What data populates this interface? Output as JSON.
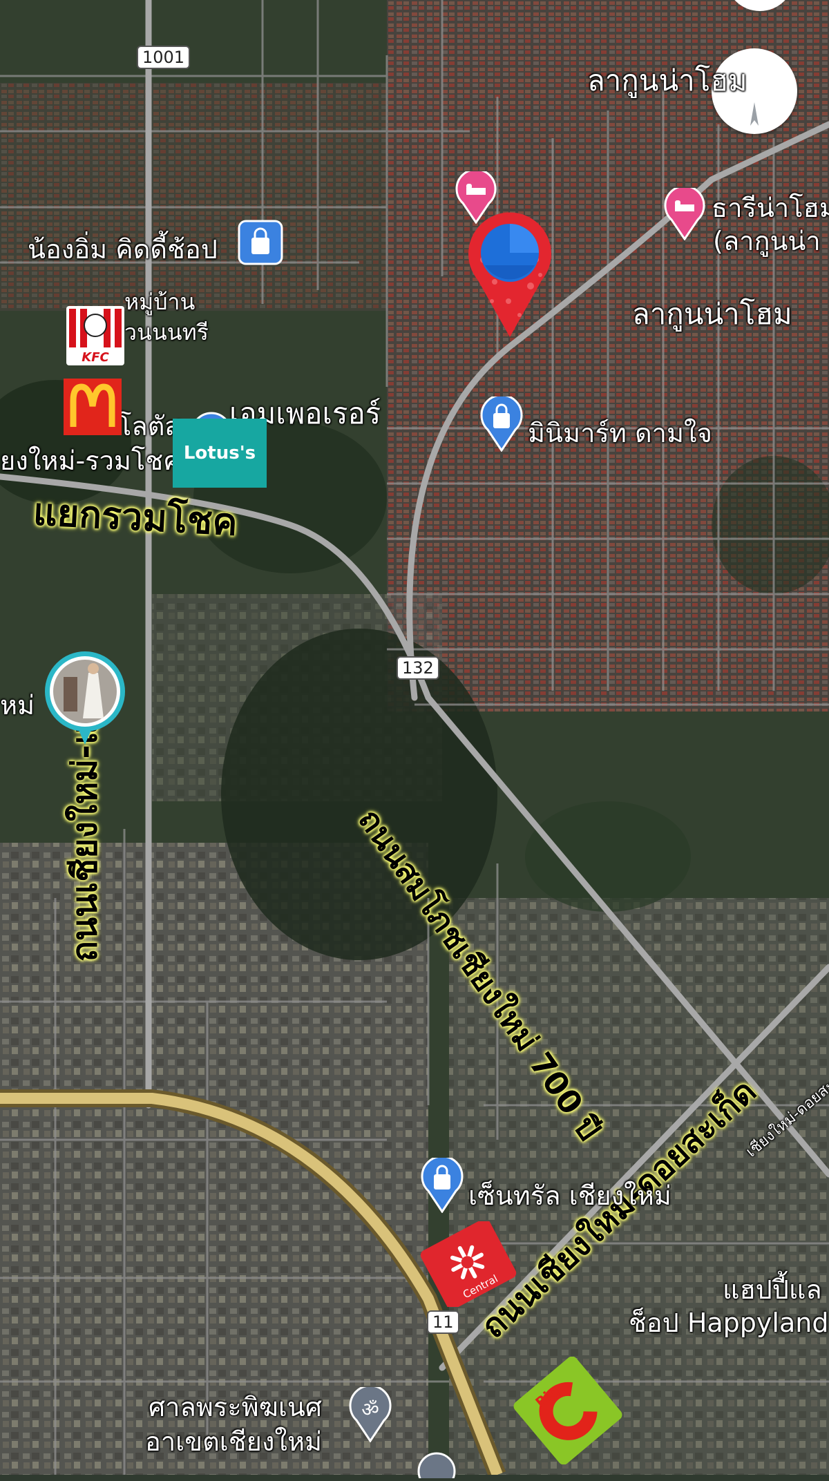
{
  "places": {
    "lagoon_top": "ลากูนน่าโฮม",
    "tharina": "ธารีน่าโฮม",
    "tharina_sub": "(ลากูนน่า",
    "lagoon_right": "ลากูนน่าโฮม",
    "nong_im": "น้องอิ่ม คิดดี้ช้อป",
    "village_line1": "หมู่บ้าน",
    "village_line2": "วนนนทรี",
    "lotus_line1": "โลตัส",
    "lotus_line2": "ยงใหม่-รวมโชค",
    "emporer": "เอมเพอเรอร์",
    "minimart": "มินิมาร์ท ดามใจ",
    "market_left": "หม่",
    "central": "เซ็นทรัล เชียงใหม่",
    "happyland_line1": "แฮปปี้แล",
    "happyland_line2": "ช็อป Happyland",
    "shrine_line1": "ศาลพระพิฆเนศ",
    "shrine_line2": "อาเขตเชียงใหม่"
  },
  "roads": {
    "junction": "แยกรวมโชค",
    "maejo": "ถนนเชียงใหม่-แม่โจ้",
    "somphot": "ถนนสมโภชเชียงใหม่ 700 ปี",
    "doisaket": "ถนนเชียงใหม่-ดอยสะเก็ด",
    "doisaket_small": "เชียงใหม่-ดอยสะเก็ด"
  },
  "route_shields": {
    "r1001": "1001",
    "r132": "132",
    "r11": "11"
  },
  "brands": {
    "lotus_logo": "Lotus's",
    "kfc_logo": "KFC",
    "central_logo": "Central",
    "bigc_logo": "Big"
  },
  "icons": {
    "hotel": "bed-icon",
    "shopping": "shopping-bag-icon",
    "fastfood": "mcdonalds-icon",
    "temple": "om-icon",
    "compass": "compass-icon",
    "location": "location-pin-icon"
  },
  "colors": {
    "highlight": "#f3ff5c",
    "highway": "#d9c27a",
    "road": "#9a9a9a",
    "pin_red": "#e3262f",
    "pin_blue": "#1e6fd9",
    "hotel_pink": "#e84a8b",
    "shop_blue": "#3b82e0"
  }
}
